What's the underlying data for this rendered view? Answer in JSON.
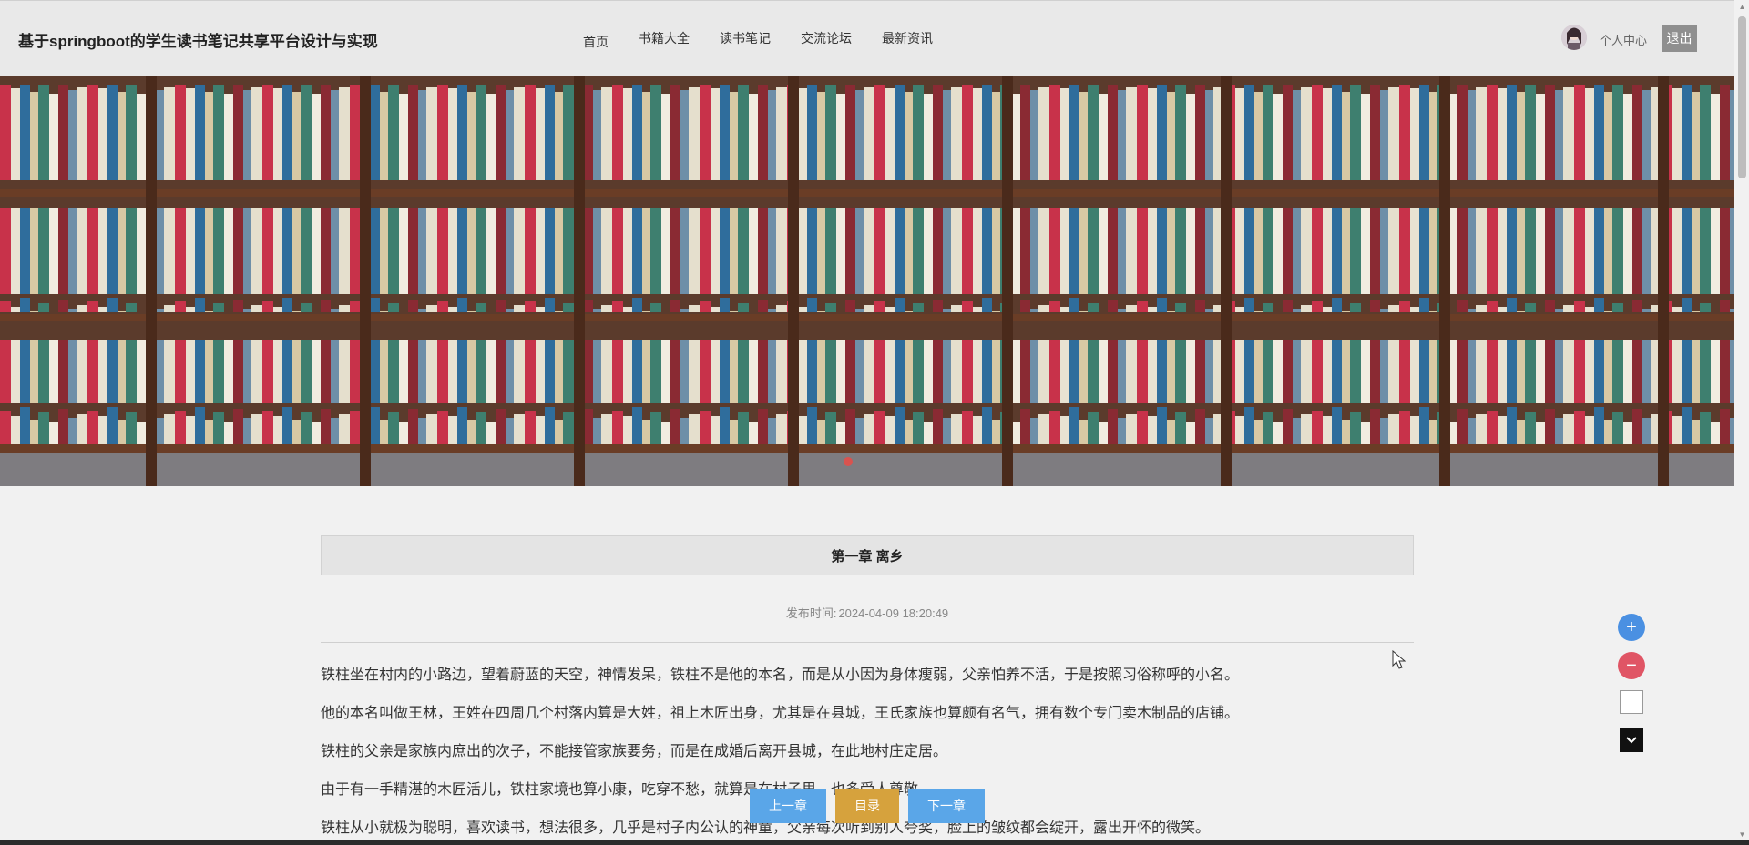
{
  "header": {
    "site_title": "基于springboot的学生读书笔记共享平台设计与实现",
    "nav": [
      {
        "label": "首页"
      },
      {
        "label": "书籍大全"
      },
      {
        "label": "读书笔记"
      },
      {
        "label": "交流论坛"
      },
      {
        "label": "最新资讯"
      }
    ],
    "profile_label": "个人中心",
    "logout_label": "退出"
  },
  "banner": {
    "icon": "bookshelf-banner-image"
  },
  "article": {
    "chapter_title": "第一章 离乡",
    "publish_label": "发布时间:",
    "publish_time": "2024-04-09 18:20:49",
    "paragraphs": [
      "铁柱坐在村内的小路边，望着蔚蓝的天空，神情发呆，铁柱不是他的本名，而是从小因为身体瘦弱，父亲怕养不活，于是按照习俗称呼的小名。",
      "他的本名叫做王林，王姓在四周几个村落内算是大姓，祖上木匠出身，尤其是在县城，王氏家族也算颇有名气，拥有数个专门卖木制品的店铺。",
      "铁柱的父亲是家族内庶出的次子，不能接管家族要务，而是在成婚后离开县城，在此地村庄定居。",
      "由于有一手精湛的木匠活儿，铁柱家境也算小康，吃穿不愁，就算是在村子里，也多受人尊敬。",
      "铁柱从小就极为聪明，喜欢读书，想法很多，几乎是村子内公认的神童，父亲每次听到别人夸奖，脸上的皱纹都会绽开，露出开怀的微笑。"
    ]
  },
  "chapter_nav": {
    "prev_label": "上一章",
    "toc_label": "目录",
    "next_label": "下一章"
  },
  "tools": {
    "zoom_in": "+",
    "zoom_out": "−"
  }
}
